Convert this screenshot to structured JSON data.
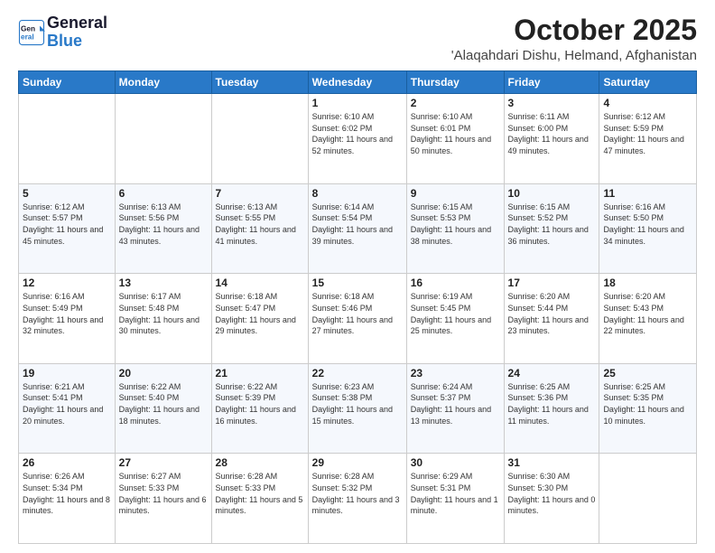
{
  "header": {
    "logo_line1": "General",
    "logo_line2": "Blue",
    "month": "October 2025",
    "location": "'Alaqahdari Dishu, Helmand, Afghanistan"
  },
  "weekdays": [
    "Sunday",
    "Monday",
    "Tuesday",
    "Wednesday",
    "Thursday",
    "Friday",
    "Saturday"
  ],
  "weeks": [
    [
      {
        "day": "",
        "sunrise": "",
        "sunset": "",
        "daylight": ""
      },
      {
        "day": "",
        "sunrise": "",
        "sunset": "",
        "daylight": ""
      },
      {
        "day": "",
        "sunrise": "",
        "sunset": "",
        "daylight": ""
      },
      {
        "day": "1",
        "sunrise": "Sunrise: 6:10 AM",
        "sunset": "Sunset: 6:02 PM",
        "daylight": "Daylight: 11 hours and 52 minutes."
      },
      {
        "day": "2",
        "sunrise": "Sunrise: 6:10 AM",
        "sunset": "Sunset: 6:01 PM",
        "daylight": "Daylight: 11 hours and 50 minutes."
      },
      {
        "day": "3",
        "sunrise": "Sunrise: 6:11 AM",
        "sunset": "Sunset: 6:00 PM",
        "daylight": "Daylight: 11 hours and 49 minutes."
      },
      {
        "day": "4",
        "sunrise": "Sunrise: 6:12 AM",
        "sunset": "Sunset: 5:59 PM",
        "daylight": "Daylight: 11 hours and 47 minutes."
      }
    ],
    [
      {
        "day": "5",
        "sunrise": "Sunrise: 6:12 AM",
        "sunset": "Sunset: 5:57 PM",
        "daylight": "Daylight: 11 hours and 45 minutes."
      },
      {
        "day": "6",
        "sunrise": "Sunrise: 6:13 AM",
        "sunset": "Sunset: 5:56 PM",
        "daylight": "Daylight: 11 hours and 43 minutes."
      },
      {
        "day": "7",
        "sunrise": "Sunrise: 6:13 AM",
        "sunset": "Sunset: 5:55 PM",
        "daylight": "Daylight: 11 hours and 41 minutes."
      },
      {
        "day": "8",
        "sunrise": "Sunrise: 6:14 AM",
        "sunset": "Sunset: 5:54 PM",
        "daylight": "Daylight: 11 hours and 39 minutes."
      },
      {
        "day": "9",
        "sunrise": "Sunrise: 6:15 AM",
        "sunset": "Sunset: 5:53 PM",
        "daylight": "Daylight: 11 hours and 38 minutes."
      },
      {
        "day": "10",
        "sunrise": "Sunrise: 6:15 AM",
        "sunset": "Sunset: 5:52 PM",
        "daylight": "Daylight: 11 hours and 36 minutes."
      },
      {
        "day": "11",
        "sunrise": "Sunrise: 6:16 AM",
        "sunset": "Sunset: 5:50 PM",
        "daylight": "Daylight: 11 hours and 34 minutes."
      }
    ],
    [
      {
        "day": "12",
        "sunrise": "Sunrise: 6:16 AM",
        "sunset": "Sunset: 5:49 PM",
        "daylight": "Daylight: 11 hours and 32 minutes."
      },
      {
        "day": "13",
        "sunrise": "Sunrise: 6:17 AM",
        "sunset": "Sunset: 5:48 PM",
        "daylight": "Daylight: 11 hours and 30 minutes."
      },
      {
        "day": "14",
        "sunrise": "Sunrise: 6:18 AM",
        "sunset": "Sunset: 5:47 PM",
        "daylight": "Daylight: 11 hours and 29 minutes."
      },
      {
        "day": "15",
        "sunrise": "Sunrise: 6:18 AM",
        "sunset": "Sunset: 5:46 PM",
        "daylight": "Daylight: 11 hours and 27 minutes."
      },
      {
        "day": "16",
        "sunrise": "Sunrise: 6:19 AM",
        "sunset": "Sunset: 5:45 PM",
        "daylight": "Daylight: 11 hours and 25 minutes."
      },
      {
        "day": "17",
        "sunrise": "Sunrise: 6:20 AM",
        "sunset": "Sunset: 5:44 PM",
        "daylight": "Daylight: 11 hours and 23 minutes."
      },
      {
        "day": "18",
        "sunrise": "Sunrise: 6:20 AM",
        "sunset": "Sunset: 5:43 PM",
        "daylight": "Daylight: 11 hours and 22 minutes."
      }
    ],
    [
      {
        "day": "19",
        "sunrise": "Sunrise: 6:21 AM",
        "sunset": "Sunset: 5:41 PM",
        "daylight": "Daylight: 11 hours and 20 minutes."
      },
      {
        "day": "20",
        "sunrise": "Sunrise: 6:22 AM",
        "sunset": "Sunset: 5:40 PM",
        "daylight": "Daylight: 11 hours and 18 minutes."
      },
      {
        "day": "21",
        "sunrise": "Sunrise: 6:22 AM",
        "sunset": "Sunset: 5:39 PM",
        "daylight": "Daylight: 11 hours and 16 minutes."
      },
      {
        "day": "22",
        "sunrise": "Sunrise: 6:23 AM",
        "sunset": "Sunset: 5:38 PM",
        "daylight": "Daylight: 11 hours and 15 minutes."
      },
      {
        "day": "23",
        "sunrise": "Sunrise: 6:24 AM",
        "sunset": "Sunset: 5:37 PM",
        "daylight": "Daylight: 11 hours and 13 minutes."
      },
      {
        "day": "24",
        "sunrise": "Sunrise: 6:25 AM",
        "sunset": "Sunset: 5:36 PM",
        "daylight": "Daylight: 11 hours and 11 minutes."
      },
      {
        "day": "25",
        "sunrise": "Sunrise: 6:25 AM",
        "sunset": "Sunset: 5:35 PM",
        "daylight": "Daylight: 11 hours and 10 minutes."
      }
    ],
    [
      {
        "day": "26",
        "sunrise": "Sunrise: 6:26 AM",
        "sunset": "Sunset: 5:34 PM",
        "daylight": "Daylight: 11 hours and 8 minutes."
      },
      {
        "day": "27",
        "sunrise": "Sunrise: 6:27 AM",
        "sunset": "Sunset: 5:33 PM",
        "daylight": "Daylight: 11 hours and 6 minutes."
      },
      {
        "day": "28",
        "sunrise": "Sunrise: 6:28 AM",
        "sunset": "Sunset: 5:33 PM",
        "daylight": "Daylight: 11 hours and 5 minutes."
      },
      {
        "day": "29",
        "sunrise": "Sunrise: 6:28 AM",
        "sunset": "Sunset: 5:32 PM",
        "daylight": "Daylight: 11 hours and 3 minutes."
      },
      {
        "day": "30",
        "sunrise": "Sunrise: 6:29 AM",
        "sunset": "Sunset: 5:31 PM",
        "daylight": "Daylight: 11 hours and 1 minute."
      },
      {
        "day": "31",
        "sunrise": "Sunrise: 6:30 AM",
        "sunset": "Sunset: 5:30 PM",
        "daylight": "Daylight: 11 hours and 0 minutes."
      },
      {
        "day": "",
        "sunrise": "",
        "sunset": "",
        "daylight": ""
      }
    ]
  ]
}
